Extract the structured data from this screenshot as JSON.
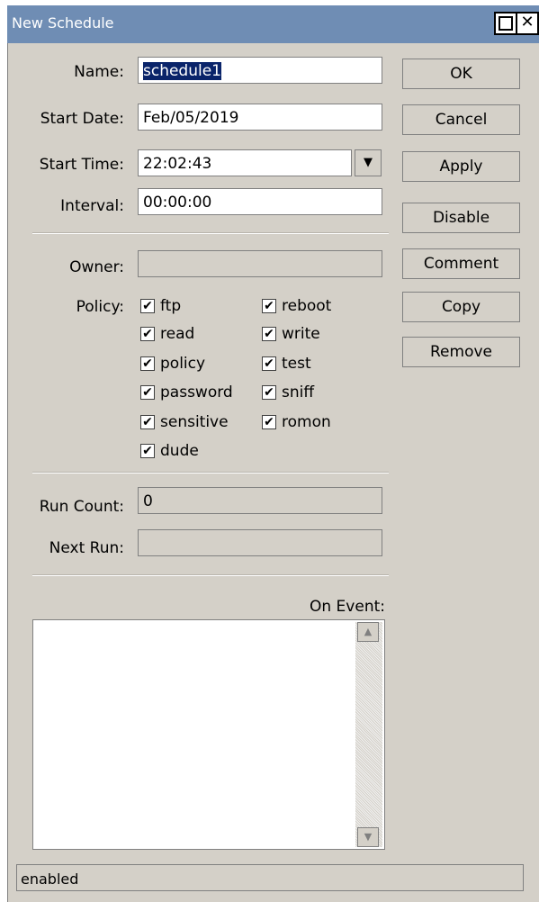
{
  "window": {
    "title": "New Schedule",
    "close_glyph": "✕"
  },
  "form": {
    "name_label": "Name:",
    "name_value": "schedule1",
    "start_date_label": "Start Date:",
    "start_date_value": "Feb/05/2019",
    "start_time_label": "Start Time:",
    "start_time_value": "22:02:43",
    "dropdown_glyph": "▼",
    "interval_label": "Interval:",
    "interval_value": "00:00:00",
    "owner_label": "Owner:",
    "owner_value": "",
    "policy_label": "Policy:",
    "run_count_label": "Run Count:",
    "run_count_value": "0",
    "next_run_label": "Next Run:",
    "next_run_value": "",
    "on_event_label": "On Event:",
    "on_event_value": ""
  },
  "policies": [
    {
      "label": "ftp",
      "checked": true
    },
    {
      "label": "reboot",
      "checked": true
    },
    {
      "label": "read",
      "checked": true
    },
    {
      "label": "write",
      "checked": true
    },
    {
      "label": "policy",
      "checked": true
    },
    {
      "label": "test",
      "checked": true
    },
    {
      "label": "password",
      "checked": true
    },
    {
      "label": "sniff",
      "checked": true
    },
    {
      "label": "sensitive",
      "checked": true
    },
    {
      "label": "romon",
      "checked": true
    },
    {
      "label": "dude",
      "checked": true
    }
  ],
  "check_glyph": "✔",
  "buttons": {
    "ok": "OK",
    "cancel": "Cancel",
    "apply": "Apply",
    "disable": "Disable",
    "comment": "Comment",
    "copy": "Copy",
    "remove": "Remove"
  },
  "scroll": {
    "up_glyph": "▲",
    "down_glyph": "▼"
  },
  "status": {
    "text": "enabled"
  }
}
